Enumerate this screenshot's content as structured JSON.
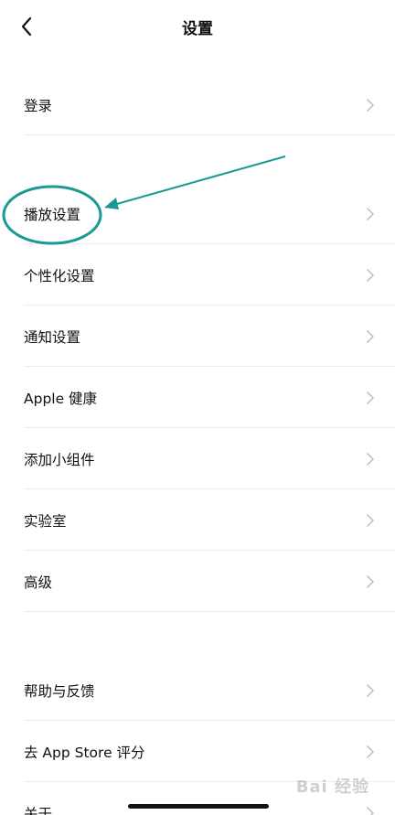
{
  "nav": {
    "title": "设置",
    "back_icon": "chevron-left-icon"
  },
  "rows": [
    {
      "label": "登录",
      "icon": "chevron-right-icon"
    },
    {
      "label": "播放设置",
      "icon": "chevron-right-icon"
    },
    {
      "label": "个性化设置",
      "icon": "chevron-right-icon"
    },
    {
      "label": "通知设置",
      "icon": "chevron-right-icon"
    },
    {
      "label": "Apple 健康",
      "icon": "chevron-right-icon"
    },
    {
      "label": "添加小组件",
      "icon": "chevron-right-icon"
    },
    {
      "label": "实验室",
      "icon": "chevron-right-icon"
    },
    {
      "label": "高级",
      "icon": "chevron-right-icon"
    },
    {
      "label": "帮助与反馈",
      "icon": "chevron-right-icon"
    },
    {
      "label": "去 App Store 评分",
      "icon": "chevron-right-icon"
    },
    {
      "label": "关于",
      "icon": "chevron-right-icon"
    }
  ],
  "annotation": {
    "color": "#1a9a94"
  },
  "watermark": "Bai 经验"
}
